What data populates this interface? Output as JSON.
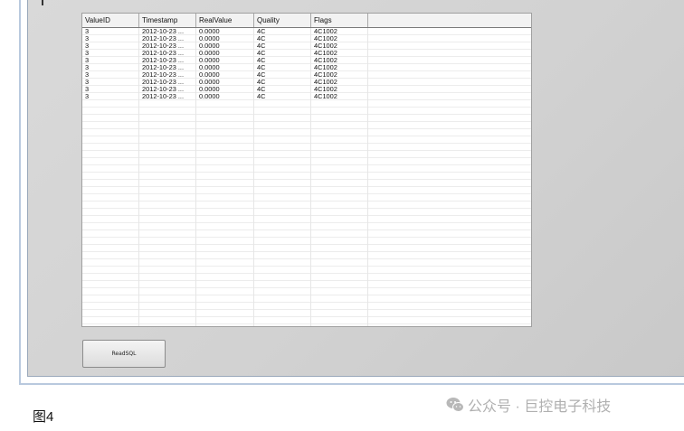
{
  "grid": {
    "columns": [
      "ValueID",
      "Timestamp",
      "RealValue",
      "Quality",
      "Flags"
    ],
    "rows": [
      [
        "3",
        "2012-10-23 ...",
        "0.0000",
        "4C",
        "4C1002"
      ],
      [
        "3",
        "2012-10-23 ...",
        "0.0000",
        "4C",
        "4C1002"
      ],
      [
        "3",
        "2012-10-23 ...",
        "0.0000",
        "4C",
        "4C1002"
      ],
      [
        "3",
        "2012-10-23 ...",
        "0.0000",
        "4C",
        "4C1002"
      ],
      [
        "3",
        "2012-10-23 ...",
        "0.0000",
        "4C",
        "4C1002"
      ],
      [
        "3",
        "2012-10-23 ...",
        "0.0000",
        "4C",
        "4C1002"
      ],
      [
        "3",
        "2012-10-23 ...",
        "0.0000",
        "4C",
        "4C1002"
      ],
      [
        "3",
        "2012-10-23 ...",
        "0.0000",
        "4C",
        "4C1002"
      ],
      [
        "3",
        "2012-10-23 ...",
        "0.0000",
        "4C",
        "4C1002"
      ],
      [
        "3",
        "2012-10-23 ...",
        "0.0000",
        "4C",
        "4C1002"
      ]
    ]
  },
  "button": {
    "label": "ReadSQL"
  },
  "caption": "图4",
  "watermark": {
    "icon": "wechat-icon",
    "text": "公众号 · 巨控电子科技"
  }
}
